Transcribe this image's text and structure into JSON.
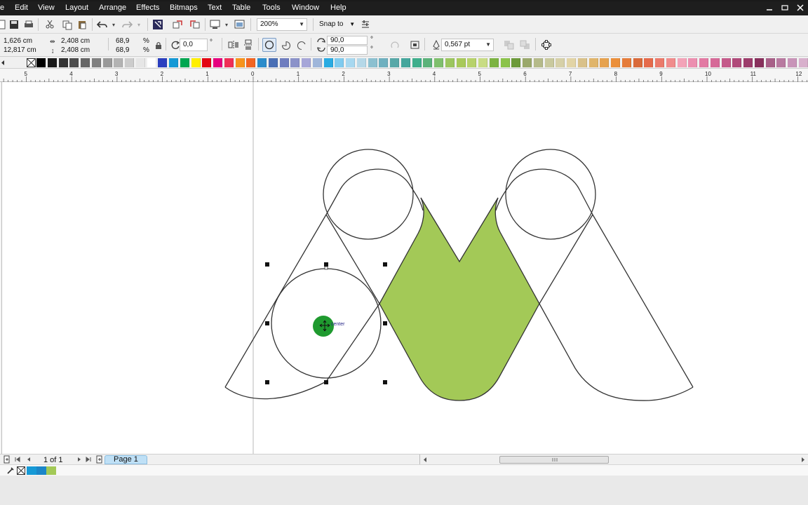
{
  "menu": {
    "items": [
      "e",
      "Edit",
      "View",
      "Layout",
      "Arrange",
      "Effects",
      "Bitmaps",
      "Text",
      "Table",
      "Tools",
      "Window",
      "Help"
    ]
  },
  "toolbar": {
    "zoom_value": "200%",
    "snap_label": "Snap to"
  },
  "property_bar": {
    "pos_x": "1,626 cm",
    "pos_y": "12,817 cm",
    "width": "2,408 cm",
    "height": "2,408 cm",
    "scale_x": "68,9",
    "scale_y": "68,9",
    "percent_symbol": "%",
    "rotation": "0,0",
    "degree_symbol": "°",
    "start_angle": "90,0",
    "end_angle": "90,0",
    "outline_width": "0,567 pt"
  },
  "palette": {
    "colors": [
      "#000000",
      "#1a1a1a",
      "#333333",
      "#4d4d4d",
      "#666666",
      "#808080",
      "#999999",
      "#b3b3b3",
      "#cccccc",
      "#e6e6e6",
      "#ffffff",
      "#2b3fbf",
      "#1599d6",
      "#00a651",
      "#ffef00",
      "#e30613",
      "#e6007e",
      "#ef2f57",
      "#f7941d",
      "#f26522",
      "#2b8ccb",
      "#4a6fb5",
      "#6f7dbf",
      "#8b92c9",
      "#a6a6d8",
      "#9fb6da",
      "#29abe2",
      "#7fcbef",
      "#a7d8f0",
      "#b5d8e8",
      "#8cc0d0",
      "#6fb0bf",
      "#58a8a8",
      "#45a69c",
      "#3fae8c",
      "#5bb27a",
      "#7fbf6d",
      "#9cc65f",
      "#a8c95a",
      "#b7d26b",
      "#c8dc84",
      "#7cb342",
      "#8bc34a",
      "#6c9a3a",
      "#9aa86b",
      "#b5ba8a",
      "#c9c99e",
      "#d6d0a8",
      "#e2d4a6",
      "#d9c18a",
      "#e0b56b",
      "#e6a24f",
      "#eb8f3a",
      "#e57c3a",
      "#d96a3a",
      "#e56a4a",
      "#eb7a6a",
      "#f08c8c",
      "#f3a3b8",
      "#ec8fb0",
      "#e27aa3",
      "#d66a98",
      "#c45a8a",
      "#b04a7a",
      "#9c3c6b",
      "#88305c",
      "#a86088",
      "#b87aa0",
      "#c894b8",
      "#d8b0cc"
    ]
  },
  "ruler": {
    "labels": [
      "5",
      "4",
      "3",
      "2",
      "1",
      "0",
      "1",
      "2",
      "3",
      "4",
      "5",
      "6",
      "7",
      "8",
      "9",
      "10",
      "11",
      "12"
    ]
  },
  "canvas": {
    "center_label": "center",
    "fill_color": "#a3c957",
    "center_marker_color": "#1f9a2f"
  },
  "status": {
    "page_counter": "1 of 1",
    "page_tab": "Page 1"
  },
  "document_colors": [
    "#1599d6",
    "#1b86c8",
    "#a3c957"
  ]
}
